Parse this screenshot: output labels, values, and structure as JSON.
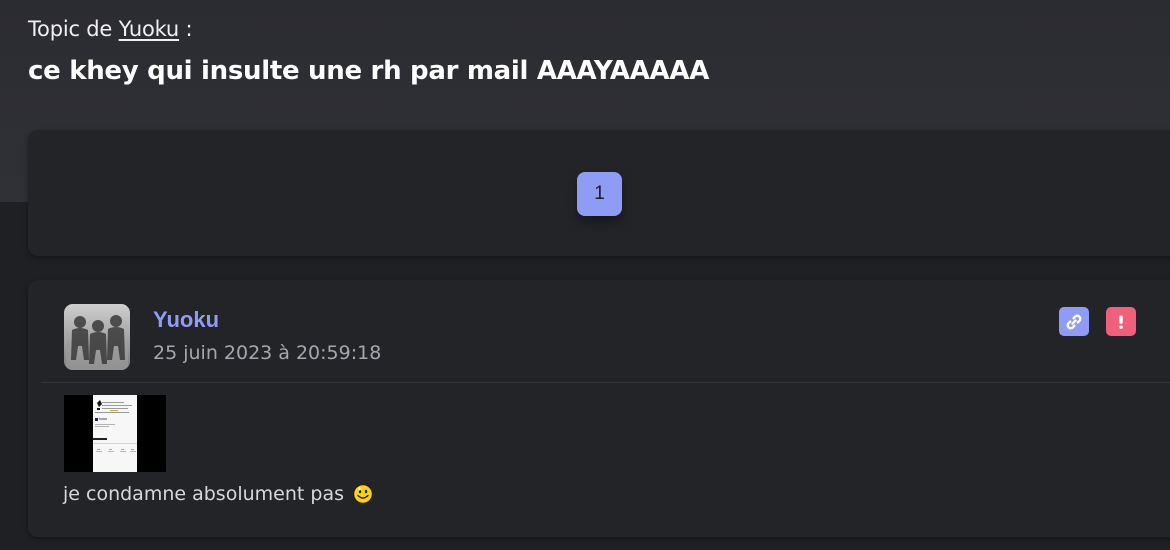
{
  "topic": {
    "prefix": "Topic de",
    "author_link": "Yuoku",
    "suffix": ":",
    "title": "ce khey qui insulte une rh par mail AAAYAAAAA"
  },
  "pagination": {
    "pages": [
      "1"
    ],
    "current": "1"
  },
  "post": {
    "author": "Yuoku",
    "date": "25 juin 2023 à 20:59:18",
    "text": "je condamne absolument pas",
    "smiley": "smile-emoji",
    "actions": {
      "permalink_icon": "link-icon",
      "report_icon": "alert-icon"
    }
  },
  "colors": {
    "accent": "#8e9cf5",
    "danger": "#f0607a",
    "card": "#232428",
    "background": "#1f2024"
  }
}
